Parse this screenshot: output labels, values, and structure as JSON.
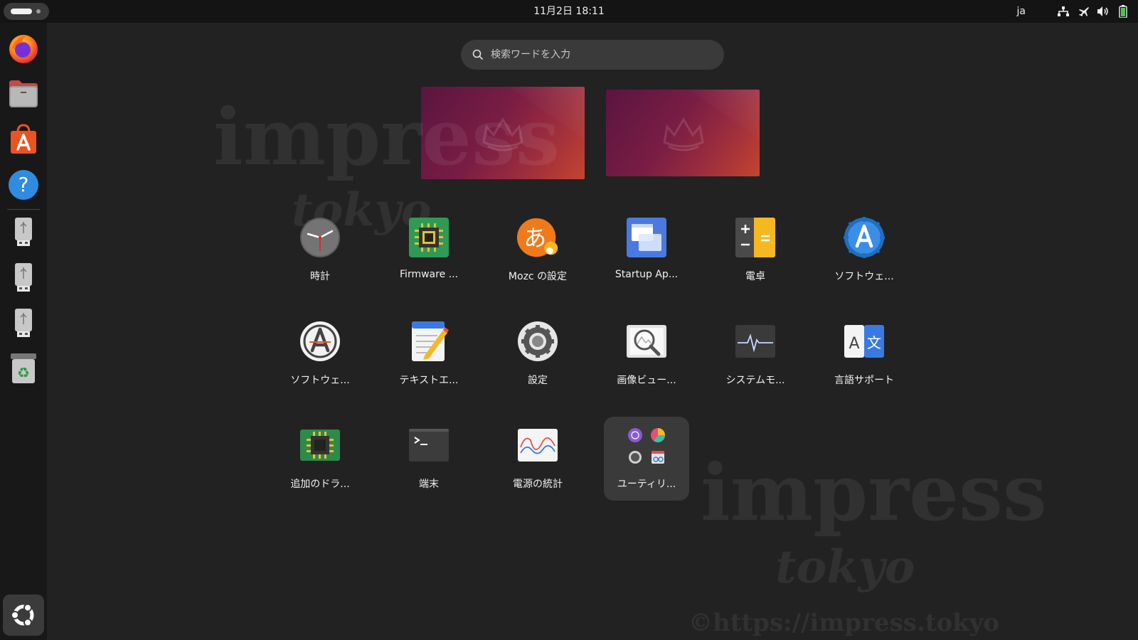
{
  "topbar": {
    "datetime": "11月2日  18:11",
    "lang": "ja"
  },
  "search": {
    "placeholder": "検索ワードを入力"
  },
  "dock": {
    "items": [
      "firefox-icon",
      "files-icon",
      "app-center-icon",
      "help-icon",
      "usb-drive-icon",
      "usb-drive-icon",
      "usb-drive-icon",
      "trash-icon"
    ]
  },
  "apps": [
    {
      "label": "時計",
      "icon": "clock-icon"
    },
    {
      "label": "Firmware ...",
      "icon": "firmware-chip-icon"
    },
    {
      "label": "Mozc の設定",
      "icon": "mozc-icon"
    },
    {
      "label": "Startup Ap...",
      "icon": "startup-applications-icon"
    },
    {
      "label": "電卓",
      "icon": "calculator-icon"
    },
    {
      "label": "ソフトウェ...",
      "icon": "software-updater-icon"
    },
    {
      "label": "ソフトウェ...",
      "icon": "software-properties-icon"
    },
    {
      "label": "テキストエ...",
      "icon": "text-editor-icon"
    },
    {
      "label": "設定",
      "icon": "settings-gear-icon"
    },
    {
      "label": "画像ビュー...",
      "icon": "image-viewer-icon"
    },
    {
      "label": "システムモ...",
      "icon": "system-monitor-icon"
    },
    {
      "label": "言語サポート",
      "icon": "language-support-icon"
    },
    {
      "label": "追加のドラ...",
      "icon": "additional-drivers-icon"
    },
    {
      "label": "端末",
      "icon": "terminal-icon"
    },
    {
      "label": "電源の統計",
      "icon": "power-statistics-icon"
    },
    {
      "label": "ユーティリ...",
      "icon": "utilities-folder-icon"
    }
  ],
  "watermark": {
    "brand": "impress",
    "city": "tokyo",
    "copyright": "©https://impress.tokyo"
  },
  "colors": {
    "accent": "#e95420",
    "background": "#222222",
    "topbar": "#141414"
  }
}
